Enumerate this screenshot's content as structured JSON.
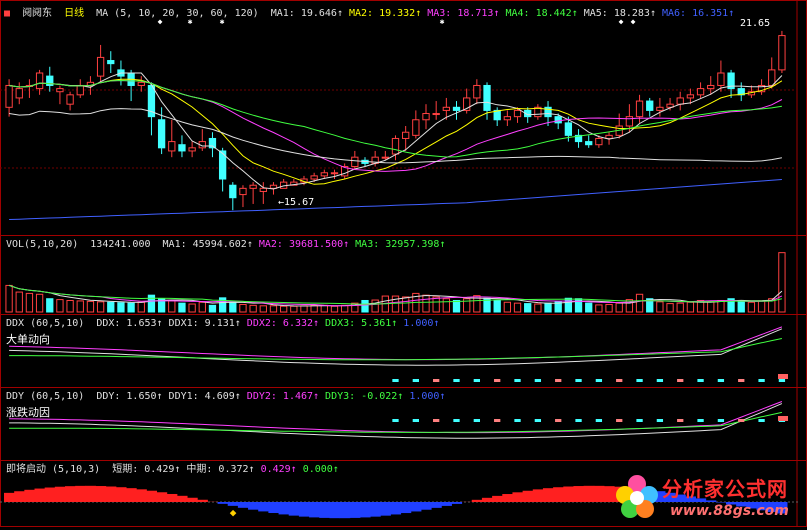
{
  "header": {
    "stock_name": "阋阋东",
    "period": "日线",
    "ma_params": "MA (5, 10, 20, 30, 60, 120)",
    "ma": [
      {
        "label": "MA1:",
        "value": "19.646",
        "color": "#e0e0e0"
      },
      {
        "label": "MA2:",
        "value": "19.332",
        "color": "#ffff00"
      },
      {
        "label": "MA3:",
        "value": "18.713",
        "color": "#ff40ff"
      },
      {
        "label": "MA4:",
        "value": "18.442",
        "color": "#40ff40"
      },
      {
        "label": "MA5:",
        "value": "18.283",
        "color": "#e0e0e0"
      },
      {
        "label": "MA6:",
        "value": "16.351",
        "color": "#4060ff"
      }
    ]
  },
  "annotations": {
    "high": "21.65",
    "low": "15.67"
  },
  "volume": {
    "title": "VOL(5,10,20)",
    "value": "134241.000",
    "ma": [
      {
        "label": "MA1:",
        "value": "45994.602",
        "color": "#e0e0e0"
      },
      {
        "label": "MA2:",
        "value": "39681.500",
        "color": "#ff40ff"
      },
      {
        "label": "MA3:",
        "value": "32957.398",
        "color": "#40ff40"
      }
    ]
  },
  "ddx": {
    "title": "DDX (60,5,10)",
    "subtitle": "大单动向",
    "items": [
      {
        "label": "DDX:",
        "value": "1.653",
        "color": "#e0e0e0"
      },
      {
        "label": "DDX1:",
        "value": "9.131",
        "color": "#e0e0e0"
      },
      {
        "label": "DDX2:",
        "value": "6.332",
        "color": "#ff40ff"
      },
      {
        "label": "DDX3:",
        "value": "5.361",
        "color": "#40ff40"
      },
      {
        "label": "",
        "value": "1.000",
        "color": "#4060ff"
      }
    ]
  },
  "ddy": {
    "title": "DDY (60,5,10)",
    "subtitle": "涨跌动因",
    "items": [
      {
        "label": "DDY:",
        "value": "1.650",
        "color": "#e0e0e0"
      },
      {
        "label": "DDY1:",
        "value": "4.609",
        "color": "#e0e0e0"
      },
      {
        "label": "DDY2:",
        "value": "1.467",
        "color": "#ff40ff"
      },
      {
        "label": "DDY3:",
        "value": "-0.022",
        "color": "#40ff40"
      },
      {
        "label": "",
        "value": "1.000",
        "color": "#4060ff"
      }
    ]
  },
  "launch": {
    "title": "即将启动 (5,10,3)",
    "items": [
      {
        "label": "短期:",
        "value": "0.429",
        "color": "#e0e0e0"
      },
      {
        "label": "中期:",
        "value": "0.372",
        "color": "#e0e0e0"
      },
      {
        "label": "",
        "value": "0.429",
        "color": "#ff40ff"
      },
      {
        "label": "",
        "value": "0.000",
        "color": "#40ff40"
      }
    ]
  },
  "colors": {
    "up": "#ff4040",
    "down": "#40ffff",
    "grid": "#a00000",
    "bg": "#000000"
  },
  "logo": {
    "text": "分析家公式网",
    "url": "www.88gs.com"
  },
  "chart_data": [
    {
      "type": "candlestick",
      "candles": [
        [
          19.2,
          19.9,
          18.9,
          20.1
        ],
        [
          19.5,
          19.8,
          19.3,
          20.0
        ],
        [
          19.9,
          19.9,
          19.5,
          20.1
        ],
        [
          19.8,
          20.3,
          19.6,
          20.4
        ],
        [
          20.2,
          19.9,
          19.7,
          20.5
        ],
        [
          19.7,
          19.8,
          19.3,
          19.9
        ],
        [
          19.3,
          19.6,
          19.1,
          19.7
        ],
        [
          19.6,
          19.9,
          19.5,
          20.1
        ],
        [
          19.9,
          20.0,
          19.6,
          20.2
        ],
        [
          20.2,
          20.8,
          20.0,
          21.2
        ],
        [
          20.7,
          20.6,
          20.3,
          21.0
        ],
        [
          20.4,
          20.2,
          19.9,
          20.7
        ],
        [
          20.3,
          19.9,
          19.4,
          20.4
        ],
        [
          19.9,
          20.0,
          19.7,
          20.2
        ],
        [
          19.9,
          18.9,
          18.3,
          20.0
        ],
        [
          18.8,
          17.9,
          17.7,
          19.2
        ],
        [
          17.8,
          18.1,
          17.6,
          18.8
        ],
        [
          18.0,
          17.8,
          17.6,
          18.3
        ],
        [
          17.8,
          17.9,
          17.6,
          18.1
        ],
        [
          17.9,
          18.1,
          17.8,
          18.5
        ],
        [
          18.2,
          17.9,
          17.6,
          18.4
        ],
        [
          17.8,
          16.9,
          16.5,
          17.9
        ],
        [
          16.7,
          16.3,
          15.9,
          16.8
        ],
        [
          16.4,
          16.6,
          16.0,
          16.7
        ],
        [
          16.6,
          16.7,
          16.1,
          16.8
        ],
        [
          16.5,
          16.6,
          16.1,
          16.8
        ],
        [
          16.6,
          16.7,
          16.4,
          16.8
        ],
        [
          16.6,
          16.8,
          16.6,
          16.9
        ],
        [
          16.7,
          16.8,
          16.7,
          16.9
        ],
        [
          16.8,
          16.9,
          16.7,
          17.0
        ],
        [
          16.9,
          17.0,
          16.8,
          17.1
        ],
        [
          17.0,
          17.1,
          16.9,
          17.2
        ],
        [
          17.1,
          17.1,
          16.9,
          17.2
        ],
        [
          17.0,
          17.3,
          16.9,
          17.4
        ],
        [
          17.3,
          17.6,
          17.2,
          17.8
        ],
        [
          17.5,
          17.4,
          17.3,
          17.6
        ],
        [
          17.4,
          17.6,
          17.3,
          17.8
        ],
        [
          17.6,
          17.6,
          17.5,
          17.8
        ],
        [
          17.7,
          18.2,
          17.5,
          18.3
        ],
        [
          18.2,
          18.4,
          17.8,
          18.6
        ],
        [
          18.3,
          18.8,
          18.2,
          19.1
        ],
        [
          18.8,
          19.0,
          18.5,
          19.3
        ],
        [
          19.0,
          19.0,
          18.8,
          19.4
        ],
        [
          19.1,
          19.2,
          18.8,
          19.5
        ],
        [
          19.2,
          19.1,
          18.8,
          19.4
        ],
        [
          19.1,
          19.5,
          19.0,
          19.8
        ],
        [
          19.5,
          19.9,
          19.3,
          20.1
        ],
        [
          19.9,
          19.1,
          18.8,
          20.0
        ],
        [
          19.1,
          18.8,
          18.6,
          19.2
        ],
        [
          18.8,
          18.9,
          18.6,
          19.1
        ],
        [
          18.9,
          19.1,
          18.7,
          19.2
        ],
        [
          19.1,
          18.9,
          18.7,
          19.2
        ],
        [
          18.9,
          19.2,
          18.8,
          19.3
        ],
        [
          19.2,
          18.9,
          18.6,
          19.4
        ],
        [
          18.9,
          18.7,
          18.5,
          19.0
        ],
        [
          18.7,
          18.3,
          18.1,
          18.9
        ],
        [
          18.3,
          18.1,
          17.9,
          18.5
        ],
        [
          18.1,
          18.0,
          17.9,
          18.3
        ],
        [
          18.0,
          18.2,
          17.9,
          18.3
        ],
        [
          18.2,
          18.3,
          18.0,
          18.4
        ],
        [
          18.3,
          18.6,
          18.2,
          19.0
        ],
        [
          18.6,
          18.9,
          18.4,
          19.3
        ],
        [
          18.9,
          19.4,
          18.7,
          19.6
        ],
        [
          19.4,
          19.1,
          18.9,
          19.5
        ],
        [
          19.1,
          19.2,
          18.9,
          19.5
        ],
        [
          19.2,
          19.3,
          19.1,
          19.5
        ],
        [
          19.3,
          19.5,
          19.1,
          19.7
        ],
        [
          19.5,
          19.6,
          19.3,
          19.8
        ],
        [
          19.6,
          19.8,
          19.5,
          20.0
        ],
        [
          19.8,
          19.9,
          19.6,
          20.2
        ],
        [
          19.9,
          20.3,
          19.7,
          20.7
        ],
        [
          20.3,
          19.8,
          19.5,
          20.4
        ],
        [
          19.8,
          19.6,
          19.4,
          20.0
        ],
        [
          19.6,
          19.7,
          19.5,
          19.9
        ],
        [
          19.7,
          19.9,
          19.6,
          20.1
        ],
        [
          19.9,
          20.4,
          19.8,
          20.8
        ],
        [
          20.4,
          21.5,
          20.3,
          21.65
        ]
      ],
      "note": "candles are [open, close, low, high]",
      "ylim": [
        15.2,
        22.0
      ]
    },
    {
      "type": "bar",
      "name": "volume",
      "values": [
        60,
        45,
        42,
        40,
        30,
        28,
        26,
        25,
        24,
        23,
        22,
        21,
        20,
        22,
        38,
        30,
        25,
        20,
        18,
        22,
        15,
        32,
        22,
        17,
        15,
        14,
        14,
        13,
        13,
        14,
        15,
        15,
        13,
        15,
        20,
        26,
        27,
        36,
        36,
        34,
        42,
        38,
        34,
        30,
        26,
        30,
        37,
        31,
        27,
        22,
        20,
        19,
        18,
        20,
        23,
        31,
        30,
        20,
        16,
        17,
        20,
        28,
        40,
        30,
        23,
        19,
        20,
        22,
        26,
        24,
        26,
        30,
        25,
        22,
        25,
        30,
        134
      ],
      "ylim": [
        0,
        140
      ]
    },
    {
      "type": "line",
      "name": "DDX",
      "ylim": [
        -2,
        10
      ]
    },
    {
      "type": "line",
      "name": "DDY",
      "ylim": [
        -2,
        6
      ]
    },
    {
      "type": "area",
      "name": "launch",
      "ylim": [
        -1,
        1
      ]
    }
  ]
}
